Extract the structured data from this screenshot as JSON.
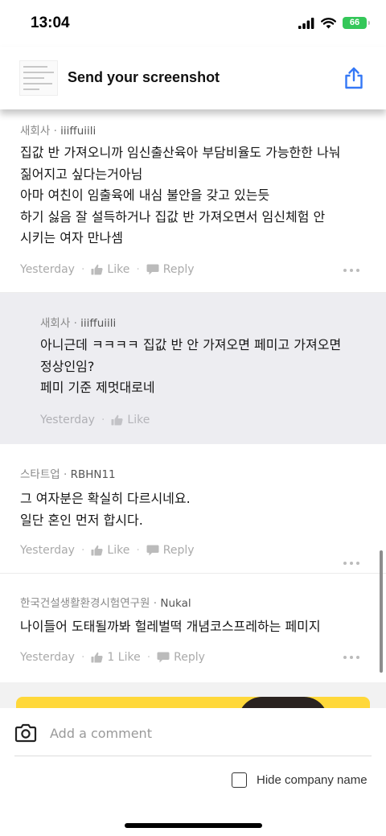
{
  "status": {
    "time": "13:04",
    "battery": "66"
  },
  "banner": {
    "title": "Send your screenshot",
    "share_icon": "share-icon"
  },
  "comments": [
    {
      "company": "새회사",
      "author": "iiiffuiili",
      "lines": [
        "집값 반 가져오니까 임신출산육아 부담비율도 가능한한 나눠",
        "짊어지고 싶다는거아님",
        "아마 여친이 임출육에 내심 불안을 갖고 있는듯",
        "하기 싫음 잘 설득하거나  집값 반 가져오면서 임신체험 안",
        "시키는 여자 만나셈"
      ],
      "time": "Yesterday",
      "like": "Like",
      "reply": "Reply"
    },
    {
      "company": "새회사",
      "author": "iiiffuiili",
      "lines": [
        "아니근데 ㅋㅋㅋㅋ 집값 반 안 가져오면 페미고 가져오면",
        "정상인임?",
        "페미 기준 제멋대로네"
      ],
      "time": "Yesterday",
      "like": "Like"
    },
    {
      "company": "스타트업",
      "author": "RBHN11",
      "lines": [
        "그 여자분은 확실히 다르시네요.",
        "일단 혼인 먼저 합시다."
      ],
      "time": "Yesterday",
      "like": "Like",
      "reply": "Reply"
    },
    {
      "company": "한국건설생활환경시험연구원",
      "author": "Nukal",
      "lines": [
        "나이들어 도태될까봐 헐레벌떡 개념코스프레하는 페미지"
      ],
      "time": "Yesterday",
      "like": "1 Like",
      "reply": "Reply"
    }
  ],
  "separator": "·",
  "composer": {
    "placeholder": "Add a comment",
    "hide_label": "Hide company name",
    "hide_checked": false
  },
  "colors": {
    "accent": "#3478f6",
    "reply_bg": "#ededf1",
    "ad_yellow": "#ffd83a",
    "battery": "#34c759"
  }
}
